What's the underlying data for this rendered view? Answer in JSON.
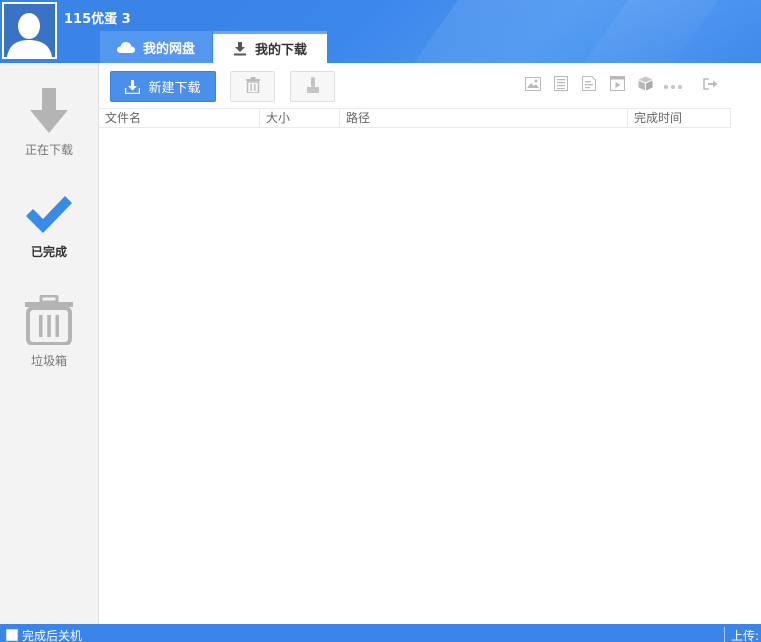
{
  "user": {
    "name": "115优蛋 3"
  },
  "tabs": [
    {
      "label": "我的网盘",
      "icon": "cloud-icon"
    },
    {
      "label": "我的下载",
      "icon": "download-icon"
    }
  ],
  "sidebar": {
    "items": [
      {
        "label": "正在下载",
        "icon": "arrow-down-icon"
      },
      {
        "label": "已完成",
        "icon": "checkmark-icon"
      },
      {
        "label": "垃圾箱",
        "icon": "trash-icon"
      }
    ]
  },
  "toolbar": {
    "new_download_label": "新建下载",
    "buttons": [
      "delete-icon",
      "upload-icon"
    ],
    "view_icons": [
      "image-icon",
      "document-icon",
      "text-icon",
      "video-icon",
      "package-icon",
      "more-icon",
      "exit-icon"
    ]
  },
  "table": {
    "columns": [
      "文件名",
      "大小",
      "路径",
      "完成时间"
    ]
  },
  "status": {
    "shutdown_label": "完成后关机",
    "upload_label": "上传:"
  },
  "colors": {
    "accent": "#3b84e8",
    "check": "#3a8ae8",
    "icon_gray": "#b4b4b4"
  }
}
